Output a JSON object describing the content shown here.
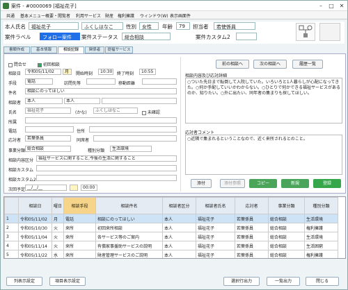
{
  "window": {
    "title": "案件 - #0000069 [福祉花子]",
    "icon": "app-icon"
  },
  "menu": [
    "共通",
    "基本メニュー",
    "概要・閲覧者",
    "利用サービス",
    "財産",
    "権利擁護",
    "ウィンドウ(W)",
    "表示画面件"
  ],
  "header": {
    "name_label": "本人氏名",
    "name": "福祉花子",
    "kana": "ふくしはなこ",
    "gender_label": "性別",
    "gender": "女性",
    "age_label": "年齢",
    "age": "79",
    "staff_label": "担当者",
    "staff": "若使係員",
    "case_label_label": "案件ラベル",
    "case_label": "フォロー案件",
    "case_status_label": "案件ステータス",
    "case_status": "総合相談",
    "custom2_label": "案件カスタム2"
  },
  "tabs": [
    "書類作成",
    "基本情報",
    "相談記録",
    "関係者",
    "提福サービス"
  ],
  "form": {
    "closed_label": "問合せ",
    "first_label": "初回相談",
    "date_label": "相談日",
    "date": "令和05/11/02",
    "weekday": "月",
    "start_label": "開始時刻",
    "start": "10:30",
    "end_label": "終了時刻",
    "end": "10:55",
    "means_label": "手段",
    "means": "電話",
    "visit_label": "訪問先等",
    "move_label": "移動距離",
    "subject_label": "件名",
    "subject": "相談にのってほしい",
    "consulter_label": "相談者",
    "consulter": "本人",
    "consulter2": "本人",
    "name_label": "氏名",
    "name": "福祉花子",
    "kana_label": "(かな)",
    "kana": "ふくしはなこ",
    "unconfirmed_label": "未確認",
    "affiliation_label": "所属",
    "phone_label": "電話",
    "address_label": "住所",
    "responder_label": "応対者",
    "responder": "若葉係員",
    "cosupport_label": "同席者",
    "class_label": "事業分類",
    "class": "総合相談",
    "type_label": "種別分類",
    "type": "生活環境",
    "content_label": "相談内容区分",
    "content": "福祉サービスに関すること,今後の生活に関すること",
    "custom_label": "相談カスタム",
    "custom2_label": "相談カスタム2",
    "next_label": "次回予定",
    "next": "__/__/__",
    "next_time": "00:00"
  },
  "right": {
    "prev_btn": "前の相談へ",
    "next_btn": "次の相談へ",
    "history_btn": "履歴一覧",
    "details_label": "相談内容及び応対詳細",
    "details": "○ついた先日まで転倒して入院していた。いろいろと1人暮らしが心配になってきた。○何か手配していいかわからない。○ひとりで何かできる福祉サービスがあるのか、知りたい。○外に出たい、同年者の集まりも探してほしい。",
    "comment_label": "応対者コメント",
    "comment": "○近隣で集まれるということなので、近く来所されるとのこと。",
    "attach_btn": "添付",
    "attach_ref_btn": "添付参照",
    "copy_btn": "コピー",
    "new_btn": "新規",
    "register_btn": "登録"
  },
  "grid": {
    "headers": [
      "相談日",
      "曜日",
      "相談手段",
      "相談件名",
      "相談者区分",
      "相談者氏名",
      "応対者",
      "事業分類",
      "種別分類"
    ],
    "rows": [
      [
        "令和05/11/02",
        "月",
        "電話",
        "相談にのってほしい",
        "本人",
        "福祉花子",
        "若葉係員",
        "総合相談",
        "生活環境"
      ],
      [
        "令和05/10/30",
        "火",
        "来所",
        "初回来所相談",
        "本人",
        "福祉花子",
        "若葉係員",
        "総合相談",
        "権利擁護"
      ],
      [
        "令和05/11/04",
        "火",
        "来所",
        "各サービス等のご案内",
        "本人",
        "福祉花子",
        "若葉係員",
        "総合相談",
        "生活環境"
      ],
      [
        "令和05/11/14",
        "火",
        "来所",
        "有償家事援助サービスの説明",
        "本人",
        "福祉花子",
        "若葉係員",
        "総合相談",
        "生活困窮"
      ],
      [
        "令和05/11/22",
        "水",
        "来所",
        "財産管理サービスのご説明",
        "本人",
        "福祉花子",
        "若葉係員",
        "総合相談",
        "権利擁護"
      ]
    ]
  },
  "footer": {
    "col_settings": "列表示設定",
    "item_settings": "項目表示設定",
    "select_output": "選択行出力",
    "list_output": "一覧出力",
    "close": "閉じる"
  }
}
